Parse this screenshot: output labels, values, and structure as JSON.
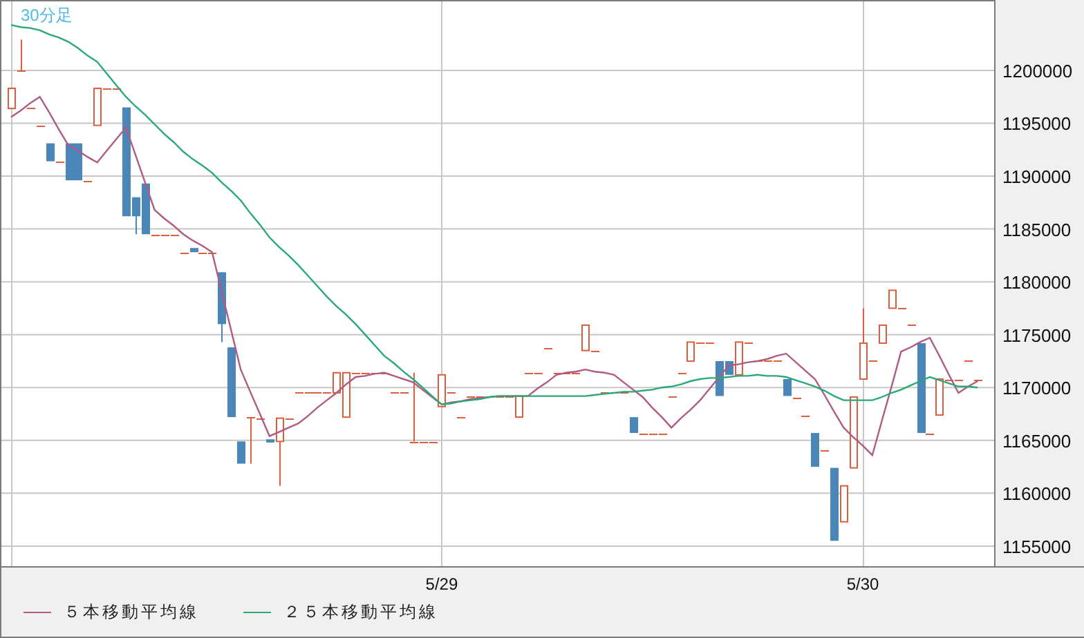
{
  "chart_data": {
    "type": "line",
    "title": "30分足",
    "grid": true,
    "categories": [
      null,
      null,
      null,
      null,
      null,
      null,
      null,
      null,
      null,
      null,
      null,
      null,
      null,
      null,
      null,
      null,
      null,
      null,
      null,
      null,
      null,
      null,
      null,
      null,
      null,
      null,
      null,
      null,
      null,
      null,
      null,
      null,
      null,
      null,
      null,
      null,
      null,
      null,
      null,
      null,
      null,
      null,
      null,
      null,
      null,
      "5/29",
      null,
      null,
      null,
      null,
      null,
      null,
      null,
      null,
      null,
      null,
      null,
      null,
      null,
      null,
      null,
      null,
      null,
      null,
      null,
      null,
      null,
      null,
      null,
      null,
      null,
      null,
      null,
      null,
      null,
      null,
      null,
      null,
      null,
      null,
      null,
      null,
      null,
      null,
      null,
      null,
      null,
      null,
      null,
      "5/30",
      null,
      null,
      null,
      null,
      null,
      null,
      null,
      null,
      null,
      null,
      null,
      null
    ],
    "ylim": [
      1153100,
      1206658
    ],
    "yticks": [
      1200000,
      1195000,
      1190000,
      1185000,
      1180000,
      1175000,
      1170000,
      1165000,
      1160000,
      1155000
    ],
    "series": [
      {
        "name": "５本移動平均線",
        "color": "#b05a84",
        "values": [
          1195600,
          1196200,
          1196900,
          1197500,
          1196000,
          1194400,
          1192900,
          1192400,
          1191800,
          1191300,
          1192400,
          1193500,
          1194600,
          1192000,
          1189400,
          1186800,
          1186000,
          1185300,
          1184500,
          1183900,
          1183400,
          1182800,
          1179100,
          1175400,
          1171700,
          1169600,
          1167500,
          1165400,
          1165800,
          1166200,
          1166600,
          1167300,
          1168100,
          1168800,
          1169500,
          1170300,
          1171000,
          1171100,
          1171300,
          1171400,
          1171100,
          1170800,
          1170500,
          1169800,
          1169100,
          1168400,
          1168600,
          1168700,
          1168900,
          1169000,
          1169100,
          1169200,
          1169200,
          1169200,
          1169200,
          1169900,
          1170500,
          1171200,
          1171400,
          1171500,
          1171700,
          1171500,
          1171400,
          1171200,
          1170500,
          1169800,
          1169100,
          1168100,
          1167200,
          1166200,
          1167100,
          1167900,
          1168800,
          1169900,
          1171000,
          1172100,
          1172200,
          1172400,
          1172500,
          1172700,
          1173000,
          1173200,
          1172400,
          1171600,
          1170800,
          1169300,
          1167700,
          1166200,
          1165300,
          1164500,
          1163600,
          1166900,
          1170100,
          1173400,
          1173800,
          1174300,
          1174700,
          1173000,
          1171200,
          1169500,
          1170100,
          1170600
        ]
      },
      {
        "name": "２５本移動平均線",
        "color": "#2aa876",
        "values": [
          1204300,
          1204100,
          1204000,
          1203800,
          1203400,
          1203100,
          1202700,
          1202100,
          1201400,
          1200800,
          1199700,
          1198600,
          1197500,
          1196600,
          1195800,
          1194900,
          1194000,
          1193200,
          1192300,
          1191600,
          1191000,
          1190300,
          1189400,
          1188600,
          1187700,
          1186500,
          1185400,
          1184200,
          1183300,
          1182500,
          1181600,
          1180600,
          1179600,
          1178600,
          1177700,
          1176900,
          1176000,
          1175000,
          1174000,
          1173000,
          1172300,
          1171500,
          1170800,
          1170000,
          1169200,
          1168400,
          1168500,
          1168700,
          1168800,
          1168900,
          1169100,
          1169200,
          1169200,
          1169200,
          1169200,
          1169200,
          1169200,
          1169200,
          1169200,
          1169200,
          1169200,
          1169300,
          1169400,
          1169500,
          1169600,
          1169600,
          1169700,
          1169800,
          1170000,
          1170100,
          1170300,
          1170600,
          1170800,
          1170900,
          1170900,
          1171000,
          1171100,
          1171100,
          1171200,
          1171100,
          1171100,
          1171000,
          1170700,
          1170400,
          1170100,
          1169700,
          1169200,
          1168800,
          1168800,
          1168800,
          1168800,
          1169100,
          1169500,
          1169800,
          1170200,
          1170600,
          1171000,
          1170700,
          1170400,
          1170100,
          1170100,
          1170000
        ]
      }
    ]
  }
}
